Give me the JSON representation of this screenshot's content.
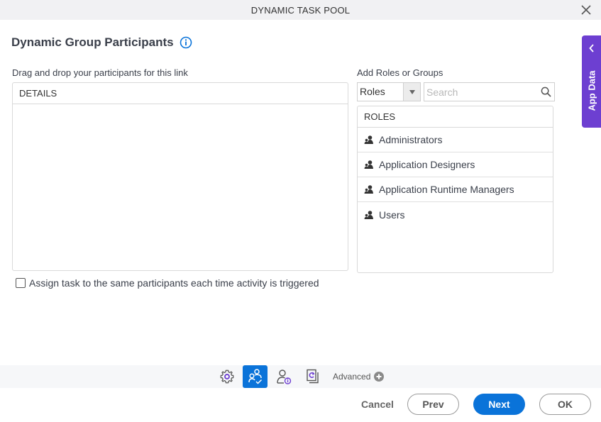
{
  "window": {
    "title": "DYNAMIC TASK POOL",
    "close_icon": "close-icon"
  },
  "heading": {
    "title": "Dynamic Group Participants",
    "info_icon": "info-icon"
  },
  "side_tab": {
    "label": "App Data",
    "icon": "chevron-left-icon",
    "color": "#6d3fd1"
  },
  "participants": {
    "label": "Drag and drop your participants for this link",
    "column_header": "DETAILS",
    "items": []
  },
  "roles_panel": {
    "label": "Add Roles or Groups",
    "type_select": {
      "value": "Roles"
    },
    "search": {
      "value": "",
      "placeholder": "Search"
    },
    "column_header": "ROLES",
    "items": [
      {
        "label": "Administrators",
        "icon": "role-icon"
      },
      {
        "label": "Application Designers",
        "icon": "role-icon"
      },
      {
        "label": "Application Runtime Managers",
        "icon": "role-icon"
      },
      {
        "label": "Users",
        "icon": "role-icon"
      }
    ]
  },
  "assign_checkbox": {
    "label": "Assign task to the same participants each time activity is triggered",
    "checked": false
  },
  "toolbar": {
    "items": [
      {
        "name": "settings",
        "icon": "gear-icon",
        "active": false
      },
      {
        "name": "participants",
        "icon": "participants-icon",
        "active": true
      },
      {
        "name": "user-info",
        "icon": "user-info-icon",
        "active": false
      },
      {
        "name": "refresh-document",
        "icon": "document-refresh-icon",
        "active": false
      }
    ],
    "advanced_label": "Advanced",
    "advanced_icon": "plus-circle-icon"
  },
  "footer": {
    "cancel": "Cancel",
    "prev": "Prev",
    "next": "Next",
    "ok": "OK"
  },
  "colors": {
    "accent": "#0a73d9",
    "purple": "#6d3fd1",
    "text": "#3a3f4a"
  }
}
